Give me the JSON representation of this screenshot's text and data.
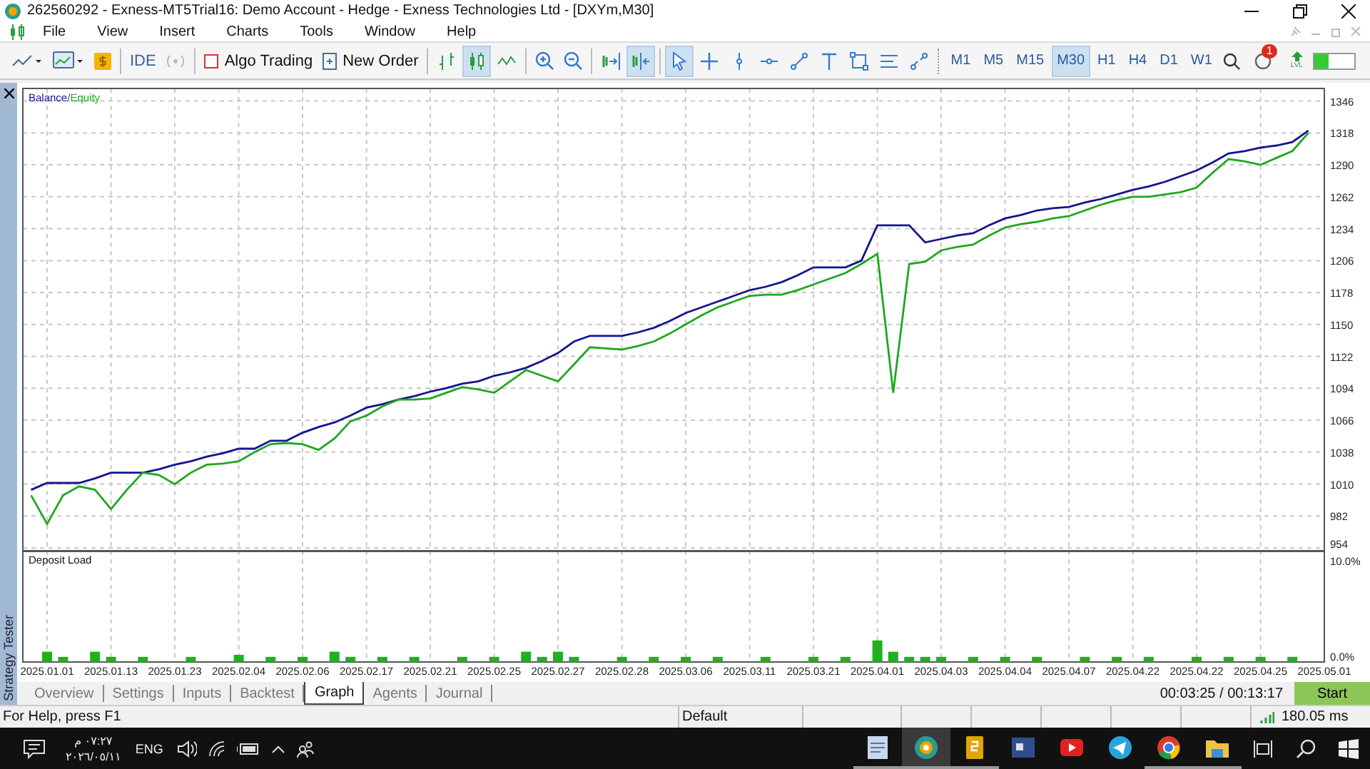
{
  "window": {
    "title": "262560292 - Exness-MT5Trial16: Demo Account - Hedge - Exness Technologies Ltd - [DXYm,M30]"
  },
  "menu": [
    "File",
    "View",
    "Insert",
    "Charts",
    "Tools",
    "Window",
    "Help"
  ],
  "toolbar": {
    "ide": "IDE",
    "algo_trading": {
      "label": "Algo Trading",
      "on": false
    },
    "new_order": "New Order",
    "chart_types": [
      {
        "kind": "bars",
        "selected": false
      },
      {
        "kind": "candles",
        "selected": true
      },
      {
        "kind": "line",
        "selected": false
      }
    ],
    "scroll": [
      {
        "kind": "scroll-end",
        "selected": false
      },
      {
        "kind": "shift",
        "selected": true
      }
    ],
    "objects": [
      {
        "kind": "cursor",
        "selected": true
      },
      {
        "kind": "crosshair",
        "selected": false
      },
      {
        "kind": "vline",
        "selected": false
      },
      {
        "kind": "hline",
        "selected": false
      },
      {
        "kind": "trend",
        "selected": false
      },
      {
        "kind": "text",
        "selected": false
      },
      {
        "kind": "rectangle",
        "selected": false
      },
      {
        "kind": "fibo",
        "selected": false
      },
      {
        "kind": "shapes",
        "selected": false
      }
    ],
    "timeframes": [
      {
        "label": "M1",
        "selected": false
      },
      {
        "label": "M5",
        "selected": false
      },
      {
        "label": "M15",
        "selected": false
      },
      {
        "label": "M30",
        "selected": true
      },
      {
        "label": "H1",
        "selected": false
      },
      {
        "label": "H4",
        "selected": false
      },
      {
        "label": "D1",
        "selected": false
      },
      {
        "label": "W1",
        "selected": false
      }
    ],
    "notification_badge": "1",
    "lvl_label": "LVL",
    "meter": {
      "level": 0.35
    }
  },
  "main_pane": {
    "legend_separator": "/",
    "chart_data": {
      "type": "line",
      "grid": true,
      "ylim": [
        951.5,
        1357
      ],
      "yticks": [
        954,
        982,
        1010,
        1038,
        1066,
        1094,
        1122,
        1150,
        1178,
        1206,
        1234,
        1262,
        1290,
        1318,
        1346
      ],
      "series": [
        {
          "name": "Balance",
          "color": "#15158f",
          "values": [
            1005,
            1011,
            1011,
            1011,
            1015,
            1020,
            1020,
            1020,
            1023,
            1027,
            1030,
            1034,
            1037,
            1041,
            1041,
            1048,
            1048,
            1055,
            1060,
            1064,
            1070,
            1077,
            1080,
            1084,
            1087,
            1091,
            1094,
            1098,
            1100,
            1105,
            1108,
            1112,
            1118,
            1125,
            1135,
            1140,
            1140,
            1140,
            1143,
            1147,
            1153,
            1160,
            1165,
            1170,
            1175,
            1180,
            1183,
            1187,
            1193,
            1200,
            1200,
            1200,
            1206,
            1237,
            1237,
            1237,
            1222,
            1225,
            1228,
            1230,
            1237,
            1243,
            1246,
            1250,
            1252,
            1253,
            1257,
            1260,
            1264,
            1268,
            1271,
            1275,
            1280,
            1285,
            1292,
            1300,
            1302,
            1305,
            1307,
            1310,
            1320,
            null
          ]
        },
        {
          "name": "Equity",
          "color": "#1fa81f",
          "values": [
            1000,
            975,
            1000,
            1008,
            1005,
            988,
            1005,
            1020,
            1018,
            1010,
            1020,
            1027,
            1028,
            1030,
            1038,
            1045,
            1046,
            1045,
            1040,
            1050,
            1065,
            1070,
            1078,
            1084,
            1084,
            1085,
            1090,
            1095,
            1093,
            1090,
            1100,
            1110,
            1105,
            1100,
            1115,
            1130,
            1129,
            1128,
            1131,
            1135,
            1142,
            1150,
            1158,
            1165,
            1170,
            1175,
            1176,
            1176,
            1180,
            1185,
            1190,
            1195,
            1203,
            1212,
            1090,
            1203,
            1205,
            1215,
            1218,
            1220,
            1228,
            1235,
            1238,
            1240,
            1243,
            1245,
            1250,
            1255,
            1259,
            1262,
            1262,
            1264,
            1266,
            1270,
            1283,
            1295,
            1293,
            1290,
            1296,
            1302,
            1318,
            null
          ]
        }
      ]
    }
  },
  "deposit_pane": {
    "chart_data": {
      "type": "bar",
      "grid": true,
      "title": "Deposit Load",
      "ylim": [
        0,
        10.83
      ],
      "yticks": [
        {
          "value": 0,
          "label": "0.0%"
        },
        {
          "value": 10,
          "label": "10.0%"
        }
      ],
      "categories": [
        null,
        "2025.01.01",
        null,
        null,
        null,
        "2025.01.13",
        null,
        null,
        null,
        "2025.01.23",
        null,
        null,
        null,
        "2025.02.04",
        null,
        null,
        null,
        "2025.02.06",
        null,
        null,
        null,
        "2025.02.17",
        null,
        null,
        null,
        "2025.02.21",
        null,
        null,
        null,
        "2025.02.25",
        null,
        null,
        null,
        "2025.02.27",
        null,
        null,
        null,
        "2025.02.28",
        null,
        null,
        null,
        "2025.03.06",
        null,
        null,
        null,
        "2025.03.11",
        null,
        null,
        null,
        "2025.03.21",
        null,
        null,
        null,
        "2025.04.01",
        null,
        null,
        null,
        "2025.04.03",
        null,
        null,
        null,
        "2025.04.04",
        null,
        null,
        null,
        "2025.04.07",
        null,
        null,
        null,
        "2025.04.22",
        null,
        null,
        null,
        "2025.04.22",
        null,
        null,
        null,
        "2025.04.25",
        null,
        null,
        null,
        "2025.05.01"
      ],
      "values": [
        null,
        1,
        0.5,
        null,
        1,
        0.5,
        null,
        0.5,
        null,
        null,
        0.5,
        null,
        null,
        0.7,
        null,
        0.5,
        null,
        0.5,
        null,
        1,
        0.5,
        null,
        0.5,
        null,
        0.5,
        null,
        null,
        0.5,
        null,
        0.5,
        null,
        1,
        0.5,
        1,
        0.5,
        null,
        null,
        0.5,
        null,
        0.5,
        null,
        0.5,
        null,
        0.5,
        null,
        null,
        0.5,
        null,
        null,
        0.5,
        null,
        0.5,
        null,
        2.1,
        1,
        0.5,
        0.5,
        0.5,
        null,
        0.5,
        null,
        0.5,
        null,
        0.5,
        null,
        null,
        0.5,
        null,
        0.5,
        null,
        0.5,
        null,
        null,
        0.5,
        null,
        0.5,
        null,
        0.5,
        null,
        0.5,
        null,
        null
      ]
    }
  },
  "tester": {
    "side_title": "Strategy Tester",
    "tabs": [
      {
        "label": "Overview",
        "selected": false
      },
      {
        "label": "Settings",
        "selected": false
      },
      {
        "label": "Inputs",
        "selected": false
      },
      {
        "label": "Backtest",
        "selected": false
      },
      {
        "label": "Graph",
        "selected": true
      },
      {
        "label": "Agents",
        "selected": false
      },
      {
        "label": "Journal",
        "selected": false
      }
    ],
    "elapsed": "00:03:25 / 00:13:17",
    "start": "Start"
  },
  "status_bar": {
    "help": "For Help, press F1",
    "profile": "Default",
    "ping": "180.05 ms"
  },
  "taskbar": {
    "time": "٠٧:٢٧ م",
    "date": "٢٠٢٦/٠٥/١١",
    "language": "ENG",
    "apps": [
      {
        "kind": "document",
        "running": true,
        "selected": false
      },
      {
        "kind": "candles",
        "running": true,
        "selected": true
      },
      {
        "kind": "tile",
        "running": true,
        "selected": false
      },
      {
        "kind": "window",
        "running": false,
        "selected": false
      },
      {
        "kind": "play",
        "running": false,
        "selected": false
      },
      {
        "kind": "plane",
        "running": false,
        "selected": false
      },
      {
        "kind": "ring",
        "running": true,
        "selected": false
      },
      {
        "kind": "folder",
        "running": true,
        "selected": false
      }
    ]
  }
}
